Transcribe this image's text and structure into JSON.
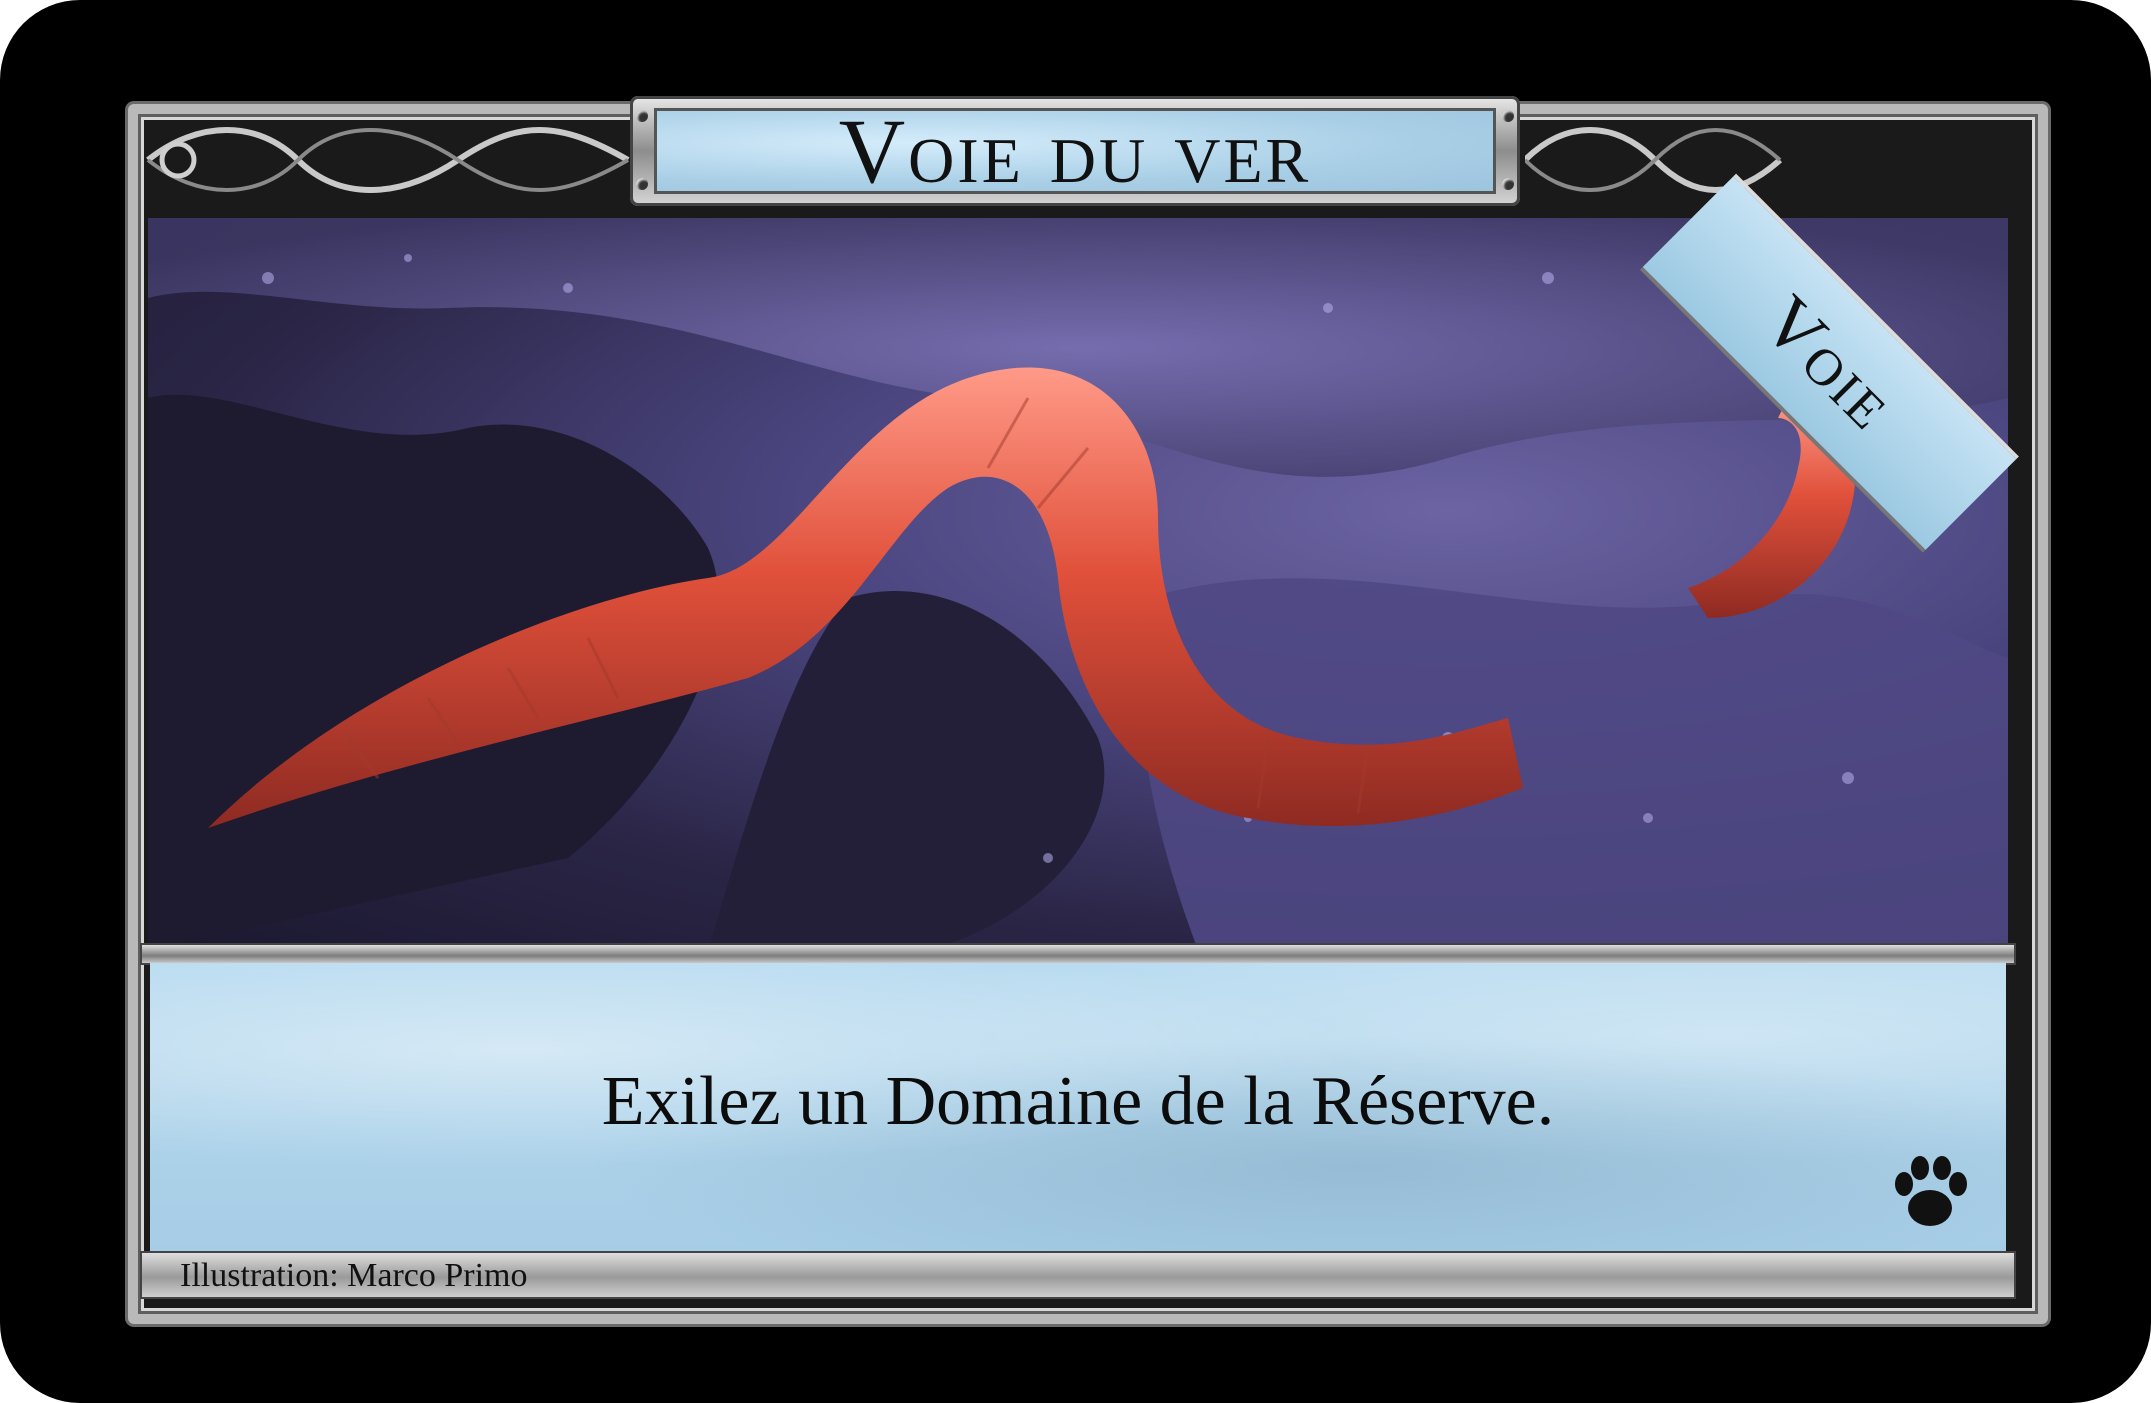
{
  "card": {
    "title": "Voie du ver",
    "type": "Voie",
    "text": "Exilez un Domaine de la Réserve.",
    "illustration_credit": "Illustration: Marco Primo",
    "set_icon": "paw-icon"
  },
  "colors": {
    "background": "#000000",
    "frame_silver": "#b9b9b9",
    "plate_blue": "#a9cfe6",
    "worm_red": "#e0503a",
    "rock_purple": "#5a528f"
  }
}
